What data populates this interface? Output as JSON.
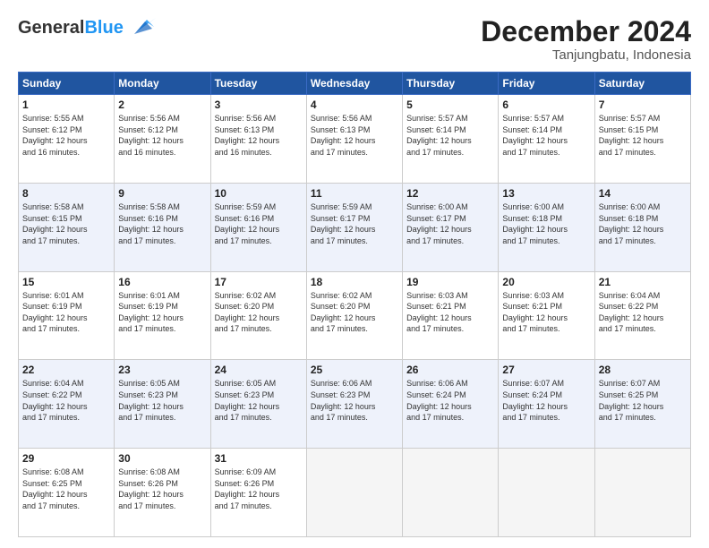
{
  "header": {
    "logo_general": "General",
    "logo_blue": "Blue",
    "month": "December 2024",
    "location": "Tanjungbatu, Indonesia"
  },
  "days_of_week": [
    "Sunday",
    "Monday",
    "Tuesday",
    "Wednesday",
    "Thursday",
    "Friday",
    "Saturday"
  ],
  "weeks": [
    [
      {
        "day": "1",
        "sunrise": "5:55 AM",
        "sunset": "6:12 PM",
        "daylight": "12 hours and 16 minutes."
      },
      {
        "day": "2",
        "sunrise": "5:56 AM",
        "sunset": "6:12 PM",
        "daylight": "12 hours and 16 minutes."
      },
      {
        "day": "3",
        "sunrise": "5:56 AM",
        "sunset": "6:13 PM",
        "daylight": "12 hours and 16 minutes."
      },
      {
        "day": "4",
        "sunrise": "5:56 AM",
        "sunset": "6:13 PM",
        "daylight": "12 hours and 17 minutes."
      },
      {
        "day": "5",
        "sunrise": "5:57 AM",
        "sunset": "6:14 PM",
        "daylight": "12 hours and 17 minutes."
      },
      {
        "day": "6",
        "sunrise": "5:57 AM",
        "sunset": "6:14 PM",
        "daylight": "12 hours and 17 minutes."
      },
      {
        "day": "7",
        "sunrise": "5:57 AM",
        "sunset": "6:15 PM",
        "daylight": "12 hours and 17 minutes."
      }
    ],
    [
      {
        "day": "8",
        "sunrise": "5:58 AM",
        "sunset": "6:15 PM",
        "daylight": "12 hours and 17 minutes."
      },
      {
        "day": "9",
        "sunrise": "5:58 AM",
        "sunset": "6:16 PM",
        "daylight": "12 hours and 17 minutes."
      },
      {
        "day": "10",
        "sunrise": "5:59 AM",
        "sunset": "6:16 PM",
        "daylight": "12 hours and 17 minutes."
      },
      {
        "day": "11",
        "sunrise": "5:59 AM",
        "sunset": "6:17 PM",
        "daylight": "12 hours and 17 minutes."
      },
      {
        "day": "12",
        "sunrise": "6:00 AM",
        "sunset": "6:17 PM",
        "daylight": "12 hours and 17 minutes."
      },
      {
        "day": "13",
        "sunrise": "6:00 AM",
        "sunset": "6:18 PM",
        "daylight": "12 hours and 17 minutes."
      },
      {
        "day": "14",
        "sunrise": "6:00 AM",
        "sunset": "6:18 PM",
        "daylight": "12 hours and 17 minutes."
      }
    ],
    [
      {
        "day": "15",
        "sunrise": "6:01 AM",
        "sunset": "6:19 PM",
        "daylight": "12 hours and 17 minutes."
      },
      {
        "day": "16",
        "sunrise": "6:01 AM",
        "sunset": "6:19 PM",
        "daylight": "12 hours and 17 minutes."
      },
      {
        "day": "17",
        "sunrise": "6:02 AM",
        "sunset": "6:20 PM",
        "daylight": "12 hours and 17 minutes."
      },
      {
        "day": "18",
        "sunrise": "6:02 AM",
        "sunset": "6:20 PM",
        "daylight": "12 hours and 17 minutes."
      },
      {
        "day": "19",
        "sunrise": "6:03 AM",
        "sunset": "6:21 PM",
        "daylight": "12 hours and 17 minutes."
      },
      {
        "day": "20",
        "sunrise": "6:03 AM",
        "sunset": "6:21 PM",
        "daylight": "12 hours and 17 minutes."
      },
      {
        "day": "21",
        "sunrise": "6:04 AM",
        "sunset": "6:22 PM",
        "daylight": "12 hours and 17 minutes."
      }
    ],
    [
      {
        "day": "22",
        "sunrise": "6:04 AM",
        "sunset": "6:22 PM",
        "daylight": "12 hours and 17 minutes."
      },
      {
        "day": "23",
        "sunrise": "6:05 AM",
        "sunset": "6:23 PM",
        "daylight": "12 hours and 17 minutes."
      },
      {
        "day": "24",
        "sunrise": "6:05 AM",
        "sunset": "6:23 PM",
        "daylight": "12 hours and 17 minutes."
      },
      {
        "day": "25",
        "sunrise": "6:06 AM",
        "sunset": "6:23 PM",
        "daylight": "12 hours and 17 minutes."
      },
      {
        "day": "26",
        "sunrise": "6:06 AM",
        "sunset": "6:24 PM",
        "daylight": "12 hours and 17 minutes."
      },
      {
        "day": "27",
        "sunrise": "6:07 AM",
        "sunset": "6:24 PM",
        "daylight": "12 hours and 17 minutes."
      },
      {
        "day": "28",
        "sunrise": "6:07 AM",
        "sunset": "6:25 PM",
        "daylight": "12 hours and 17 minutes."
      }
    ],
    [
      {
        "day": "29",
        "sunrise": "6:08 AM",
        "sunset": "6:25 PM",
        "daylight": "12 hours and 17 minutes."
      },
      {
        "day": "30",
        "sunrise": "6:08 AM",
        "sunset": "6:26 PM",
        "daylight": "12 hours and 17 minutes."
      },
      {
        "day": "31",
        "sunrise": "6:09 AM",
        "sunset": "6:26 PM",
        "daylight": "12 hours and 17 minutes."
      },
      null,
      null,
      null,
      null
    ]
  ],
  "labels": {
    "sunrise": "Sunrise:",
    "sunset": "Sunset:",
    "daylight": "Daylight:"
  }
}
